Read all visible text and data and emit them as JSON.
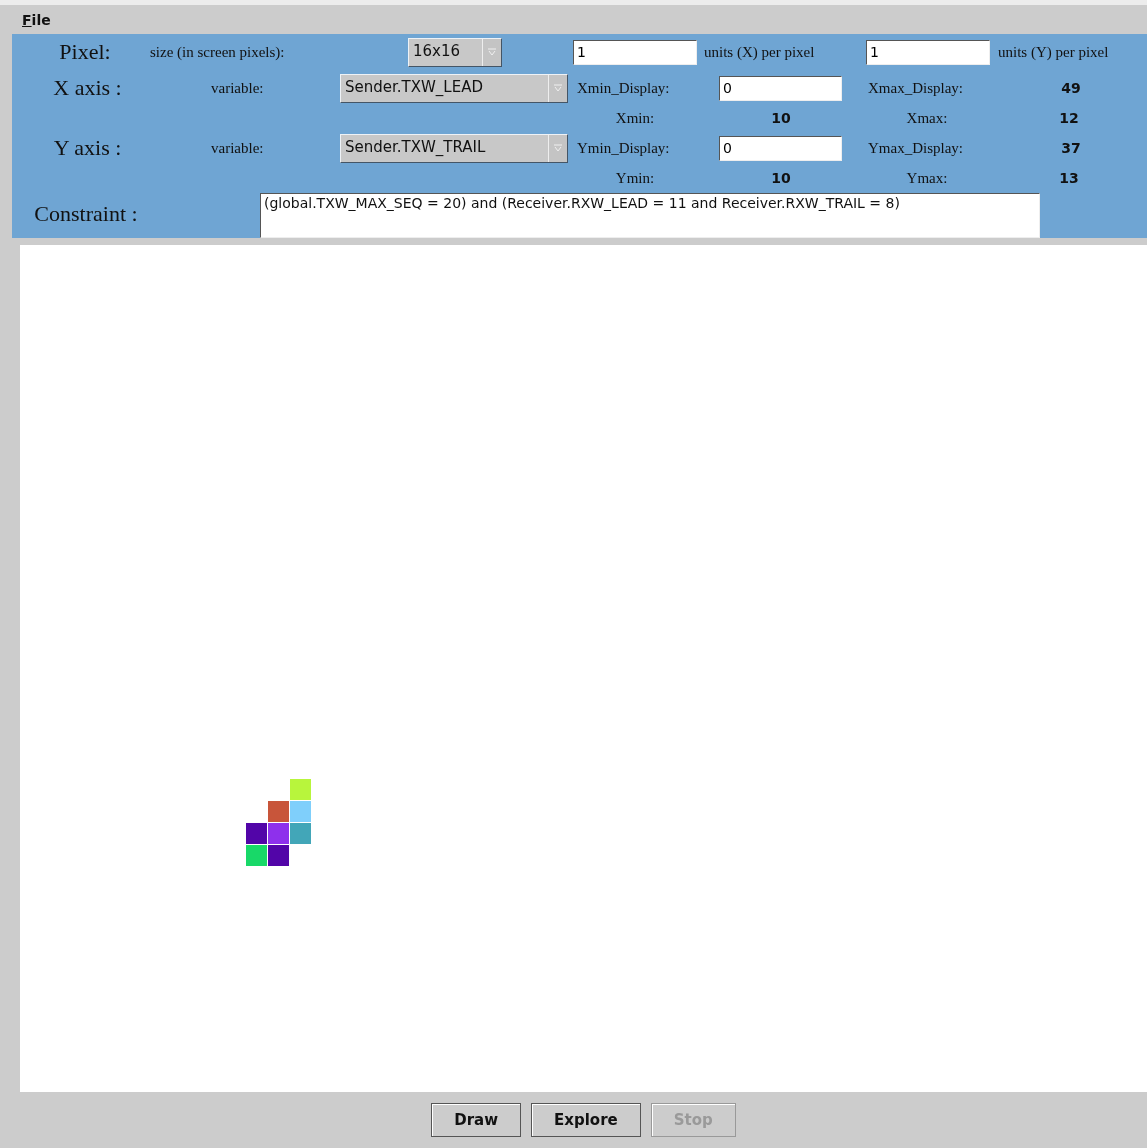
{
  "menu": [
    {
      "label": "File"
    }
  ],
  "pixel": {
    "label": "Pixel:",
    "size_label": "size (in screen pixels):",
    "size": "16x16",
    "x_units": "1",
    "x_units_label": "units (X) per pixel",
    "y_units": "1",
    "y_units_label": "units (Y) per pixel"
  },
  "axes": [
    {
      "label": "X axis :",
      "variable_label": "variable:",
      "variable": "Sender.TXW_LEAD",
      "display_min_label": "Xmin_Display:",
      "display_min": "0",
      "display_max_label": "Xmax_Display:",
      "display_max": "49",
      "min_label": "Xmin:",
      "min": "10",
      "max_label": "Xmax:",
      "max": "12"
    },
    {
      "label": "Y axis :",
      "variable_label": "variable:",
      "variable": "Sender.TXW_TRAIL",
      "display_min_label": "Ymin_Display:",
      "display_min": "0",
      "display_max_label": "Ymax_Display:",
      "display_max": "37",
      "min_label": "Ymin:",
      "min": "10",
      "max_label": "Ymax:",
      "max": "13"
    }
  ],
  "constraint": {
    "label": "Constraint :",
    "value": "(global.TXW_MAX_SEQ = 20) and (Receiver.RXW_LEAD = 11  and Receiver.RXW_TRAIL = 8)"
  },
  "plot": {
    "rows": [
      {
        "cells": [
          null,
          null,
          {
            "color": "#b8f53c"
          }
        ]
      },
      {
        "cells": [
          null,
          {
            "color": "#c8553a"
          },
          {
            "color": "#7fcffb"
          }
        ]
      },
      {
        "cells": [
          {
            "color": "#5205a8"
          },
          {
            "color": "#8e30ec"
          },
          {
            "color": "#42a6b8"
          }
        ]
      },
      {
        "cells": [
          {
            "color": "#18d868"
          },
          {
            "color": "#5205a8"
          },
          null
        ]
      }
    ]
  },
  "buttons": [
    {
      "label": "Draw",
      "disabled": false
    },
    {
      "label": "Explore",
      "disabled": false
    },
    {
      "label": "Stop",
      "disabled": true
    }
  ]
}
